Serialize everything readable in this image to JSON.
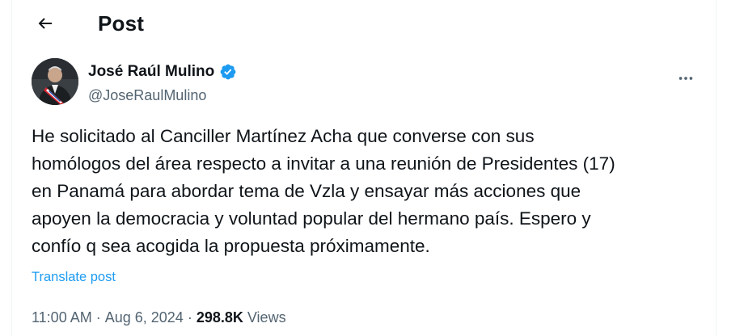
{
  "header": {
    "back_icon": "arrow-left-icon",
    "title": "Post"
  },
  "author": {
    "display_name": "José Raúl Mulino",
    "handle": "@JoseRaulMulino",
    "verified_icon": "verified-badge-icon",
    "verified_color": "#1d9bf0"
  },
  "post": {
    "text_lines": [
      "He solicitado al Canciller Martínez Acha que converse con sus",
      "homólogos del área respecto a invitar a una reunión de Presidentes (17)",
      "en Panamá para abordar tema de Vzla y ensayar más acciones que",
      "apoyen la democracia y voluntad popular del hermano país. Espero y",
      "confío q sea acogida la propuesta próximamente."
    ],
    "translate_label": "Translate post",
    "time": "11:00 AM",
    "separator": "·",
    "date": "Aug 6, 2024",
    "views_count": "298.8K",
    "views_label": "Views",
    "more_icon": "more-horizontal-icon"
  },
  "colors": {
    "text": "#0f1419",
    "secondary": "#536471",
    "link": "#1d9bf0"
  }
}
